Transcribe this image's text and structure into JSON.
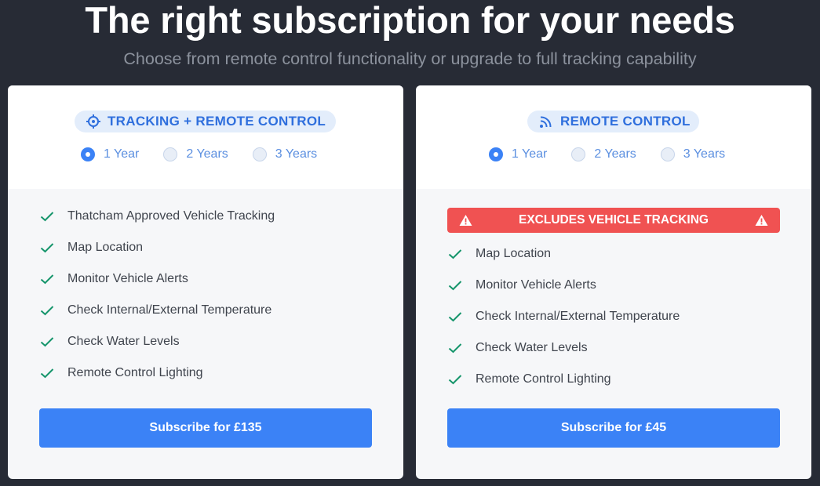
{
  "hero": {
    "title": "The right subscription for your needs",
    "subtitle": "Choose from remote control functionality or upgrade to full tracking capability"
  },
  "colors": {
    "background": "#272b35",
    "accent": "#3b82f6",
    "badge_text": "#2f6fdd",
    "check": "#15956b",
    "warning": "#f05252"
  },
  "plans": [
    {
      "badge": "TRACKING + REMOTE CONTROL",
      "badge_icon": "crosshair-icon",
      "terms": [
        {
          "label": "1 Year",
          "selected": true
        },
        {
          "label": "2 Years",
          "selected": false
        },
        {
          "label": "3 Years",
          "selected": false
        }
      ],
      "features": [
        "Thatcham Approved Vehicle Tracking",
        "Map Location",
        "Monitor Vehicle Alerts",
        "Check Internal/External Temperature",
        "Check Water Levels",
        "Remote Control Lighting"
      ],
      "subscribe_label": "Subscribe for £135"
    },
    {
      "badge": "REMOTE CONTROL",
      "badge_icon": "signal-icon",
      "warning": "EXCLUDES VEHICLE TRACKING",
      "terms": [
        {
          "label": "1 Year",
          "selected": true
        },
        {
          "label": "2 Years",
          "selected": false
        },
        {
          "label": "3 Years",
          "selected": false
        }
      ],
      "features": [
        "Map Location",
        "Monitor Vehicle Alerts",
        "Check Internal/External Temperature",
        "Check Water Levels",
        "Remote Control Lighting"
      ],
      "subscribe_label": "Subscribe for £45"
    }
  ]
}
